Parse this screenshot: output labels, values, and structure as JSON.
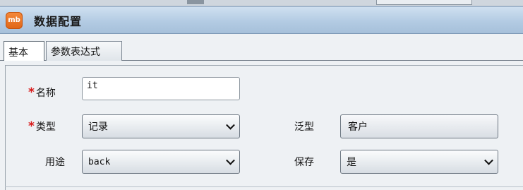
{
  "window": {
    "title": "数据配置",
    "logo_text": "mb"
  },
  "tabs": [
    {
      "label": "基本"
    },
    {
      "label": "参数表达式"
    }
  ],
  "form": {
    "required_marker": "*",
    "name": {
      "label": "名称",
      "value": "it"
    },
    "type": {
      "label": "类型",
      "value": "记录"
    },
    "generic": {
      "label": "泛型",
      "value": "客户"
    },
    "usage": {
      "label": "用途",
      "value": "back"
    },
    "save": {
      "label": "保存",
      "value": "是"
    }
  },
  "colors": {
    "accent": "#b3cbe3",
    "required": "#d81b1b",
    "logo": "#e06515"
  }
}
